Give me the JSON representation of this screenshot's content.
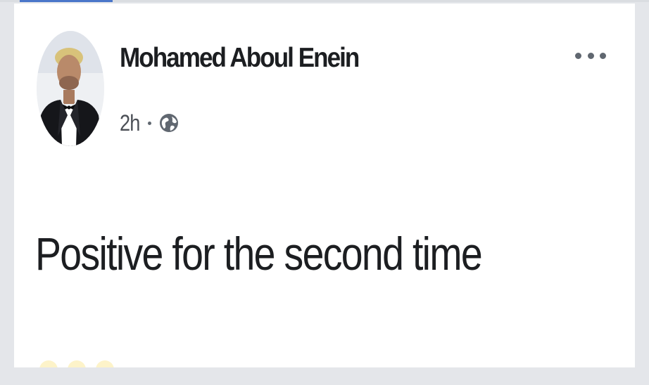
{
  "post": {
    "author": "Mohamed Aboul Enein",
    "timestamp": "2h",
    "audience_icon": "globe-icon",
    "text": "Positive for the second time",
    "more_icon": "more-options-icon",
    "avatar_icon": "profile-photo"
  },
  "colors": {
    "background": "#e4e6ea",
    "card": "#ffffff",
    "text_primary": "#1c1e21",
    "text_secondary": "#606770",
    "accent": "#4a76c9"
  }
}
